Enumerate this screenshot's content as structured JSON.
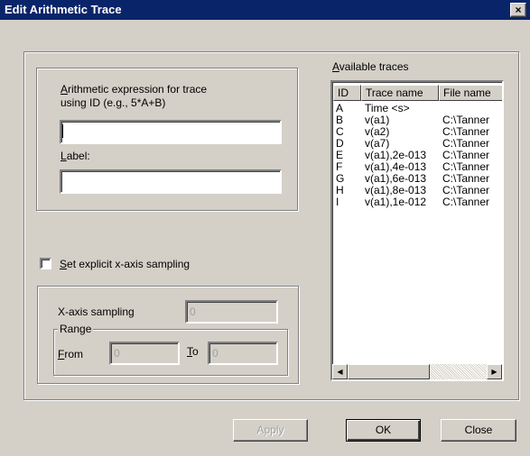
{
  "window": {
    "title": "Edit Arithmetic Trace",
    "close_glyph": "×"
  },
  "expression": {
    "label_line1": "rithmetic expression for trace",
    "label_line1_mnemonic": "A",
    "label_line2": "using ID (e.g., 5*A+B)",
    "value": ""
  },
  "label_field": {
    "label": "abel:",
    "label_mnemonic": "L",
    "value": ""
  },
  "sampling_checkbox": {
    "label": "et explicit x-axis sampling",
    "label_mnemonic": "S",
    "checked": false
  },
  "xaxis": {
    "sampling_label": "X-axis sampling",
    "sampling_value": "0",
    "range_label": "Range",
    "from_label": "rom",
    "from_mnemonic": "F",
    "from_value": "0",
    "to_label": "o",
    "to_mnemonic": "T",
    "to_value": "0"
  },
  "traces": {
    "label": "vailable traces",
    "label_mnemonic": "A",
    "columns": [
      "ID",
      "Trace name",
      "File name"
    ],
    "rows": [
      {
        "id": "A",
        "name": "Time <s>",
        "file": ""
      },
      {
        "id": "B",
        "name": "v(a1)",
        "file": "C:\\Tanner"
      },
      {
        "id": "C",
        "name": "v(a2)",
        "file": "C:\\Tanner"
      },
      {
        "id": "D",
        "name": "v(a7)",
        "file": "C:\\Tanner"
      },
      {
        "id": "E",
        "name": "v(a1),2e-013",
        "file": "C:\\Tanner"
      },
      {
        "id": "F",
        "name": "v(a1),4e-013",
        "file": "C:\\Tanner"
      },
      {
        "id": "G",
        "name": "v(a1),6e-013",
        "file": "C:\\Tanner"
      },
      {
        "id": "H",
        "name": "v(a1),8e-013",
        "file": "C:\\Tanner"
      },
      {
        "id": "I",
        "name": "v(a1),1e-012",
        "file": "C:\\Tanner"
      }
    ]
  },
  "buttons": {
    "apply": "Apply",
    "ok": "OK",
    "close": "Close"
  },
  "icons": {
    "scroll_left": "◀",
    "scroll_right": "▶"
  },
  "colors": {
    "titlebar": "#0a246a",
    "face": "#d4d0c8"
  }
}
